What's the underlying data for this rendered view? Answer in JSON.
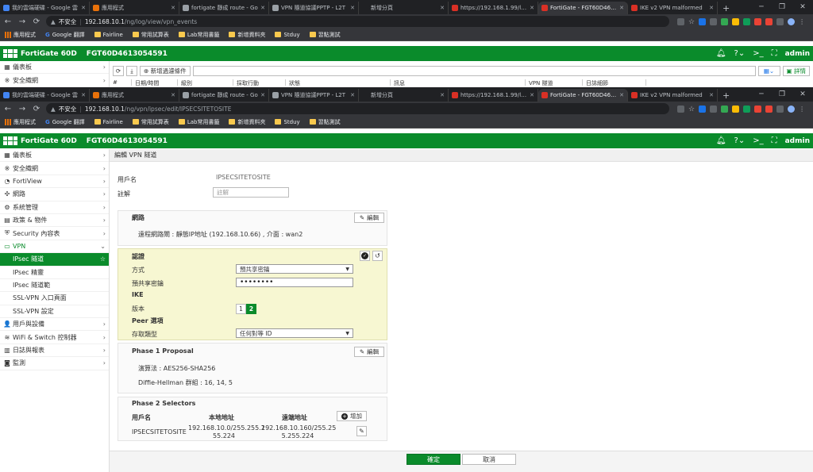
{
  "tabs": [
    {
      "title": "我的雲端硬碟 - Google 雲",
      "color": "#4285f4",
      "active": false
    },
    {
      "title": "應用程式",
      "color": "#e8710a",
      "active": false
    },
    {
      "title": "fortigate 靜成 route - Go",
      "color": "#9aa0a6",
      "active": false
    },
    {
      "title": "VPN 隨道協議PPTP - L2T",
      "color": "#9aa0a6",
      "active": false
    },
    {
      "title": "新增分頁",
      "color": "",
      "active": false
    },
    {
      "title": "https://192.168.1.99/log",
      "color": "#d93025",
      "active": false
    },
    {
      "title": "FortiGate - FGT60D4613",
      "color": "#d93025",
      "active": true
    },
    {
      "title": "IKE v2 VPN malformed",
      "color": "#d93025",
      "active": false
    }
  ],
  "top": {
    "url_warning": "不安全",
    "url_host": "192.168.10.1",
    "url_path": "/ng/log/view/vpn_events",
    "sidebar": [
      {
        "icon": "▦",
        "label": "儀表板"
      },
      {
        "icon": "※",
        "label": "安全織網"
      }
    ],
    "new_filter": "新增過濾條件",
    "details": "詳情",
    "columns": [
      "#",
      "日期/時間",
      "級別",
      "採取行動",
      "狀態",
      "訊息",
      "VPN 隧道",
      "日誌細節"
    ]
  },
  "url_warning": "不安全",
  "url_host": "192.168.10.1",
  "url_path": "/ng/vpn/ipsec/edit/IPSECSITETOSITE",
  "bookmarks": [
    {
      "label": "應用程式",
      "type": "grid"
    },
    {
      "label": "Google 翻譯",
      "type": "g"
    },
    {
      "label": "Fairline",
      "type": "folder"
    },
    {
      "label": "常用試算表",
      "type": "folder"
    },
    {
      "label": "Lab常用書籤",
      "type": "folder"
    },
    {
      "label": "新增資料夾",
      "type": "folder"
    },
    {
      "label": "Stduy",
      "type": "folder"
    },
    {
      "label": "習點測試",
      "type": "folder"
    }
  ],
  "fortigate": {
    "name": "FortiGate 60D",
    "serial": "FGT60D4613054591",
    "user": "admin",
    "notify_count": "1"
  },
  "sidebar": [
    {
      "icon": "▦",
      "label": "儀表板",
      "chev": "›",
      "type": "top"
    },
    {
      "icon": "※",
      "label": "安全織網",
      "chev": "›",
      "type": "top"
    },
    {
      "icon": "◔",
      "label": "FortiView",
      "chev": "›",
      "type": "top"
    },
    {
      "icon": "✣",
      "label": "網路",
      "chev": "›",
      "type": "top"
    },
    {
      "icon": "⚙",
      "label": "系統管理",
      "chev": "›",
      "type": "top"
    },
    {
      "icon": "▤",
      "label": "政策 & 物件",
      "chev": "›",
      "type": "top"
    },
    {
      "icon": "⛨",
      "label": "Security 內容表",
      "chev": "›",
      "type": "top"
    },
    {
      "icon": "▭",
      "label": "VPN",
      "chev": "⌄",
      "type": "open"
    },
    {
      "icon": "",
      "label": "IPsec 隧道",
      "chev": "☆",
      "type": "active"
    },
    {
      "icon": "",
      "label": "IPsec 精靈",
      "chev": "",
      "type": "sub"
    },
    {
      "icon": "",
      "label": "IPsec 隧道範",
      "chev": "",
      "type": "sub"
    },
    {
      "icon": "",
      "label": "SSL-VPN 入口頁面",
      "chev": "",
      "type": "sub"
    },
    {
      "icon": "",
      "label": "SSL-VPN 設定",
      "chev": "",
      "type": "sub"
    },
    {
      "icon": "👤",
      "label": "用戶與設備",
      "chev": "›",
      "type": "top"
    },
    {
      "icon": "≋",
      "label": "WiFi & Switch 控制器",
      "chev": "›",
      "type": "top"
    },
    {
      "icon": "▥",
      "label": "日誌與報表",
      "chev": "›",
      "type": "top"
    },
    {
      "icon": "◙",
      "label": "監測",
      "chev": "›",
      "type": "top"
    }
  ],
  "page": {
    "title": "編輯 VPN 隧道",
    "name_label": "用戶名",
    "name_value": "IPSECSITETOSITE",
    "comment_label": "註解",
    "comment_placeholder": "註解"
  },
  "network": {
    "title": "網路",
    "edit": "編輯",
    "remote_gateway": "遠程網路閘 : 靜態IP地址 (192.168.10.66) , 介面 : wan2"
  },
  "auth": {
    "title": "認證",
    "method_label": "方式",
    "method_value": "預共享密鑰",
    "psk_label": "預共享密鑰",
    "psk_value": "••••••••",
    "ike_label": "IKE",
    "version_label": "版本",
    "version_options": [
      "1",
      "2"
    ],
    "version_selected": "2",
    "peer_label": "Peer 選項",
    "accept_label": "存取類型",
    "accept_value": "任何對等 ID"
  },
  "phase1": {
    "title": "Phase 1 Proposal",
    "edit": "編輯",
    "encryption": "演算法 : AES256-SHA256",
    "dh": "Diffie-Hellman 群組 : 16, 14, 5"
  },
  "phase2": {
    "title": "Phase 2 Selectors",
    "headers": [
      "用戶名",
      "本地地址",
      "遠端地址"
    ],
    "add": "增加",
    "row": {
      "name": "IPSECSITETOSITE",
      "local": "192.168.10.0/255.255.255.224",
      "local_l1": "192.168.10.0/255.255.2",
      "local_l2": "55.224",
      "remote_l1": "192.168.10.160/255.25",
      "remote_l2": "5.255.224"
    }
  },
  "footer": {
    "ok": "確定",
    "cancel": "取消"
  }
}
